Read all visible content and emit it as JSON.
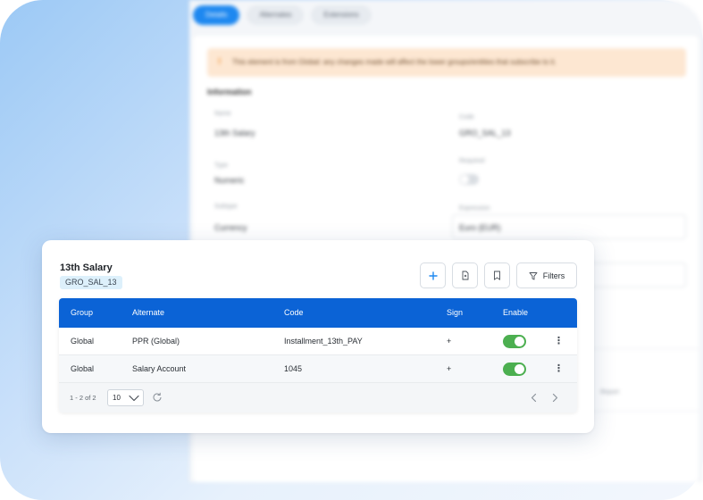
{
  "background": {
    "tabs": [
      "Details",
      "Alternates",
      "Extensions"
    ],
    "warning": "This element is from Global: any changes made will affect the lower groups/entities that subscribe to it.",
    "section_title": "Information",
    "fields": {
      "name_label": "Name",
      "name_value": "13th Salary",
      "code_label": "Code",
      "code_value": "GRO_SAL_13",
      "type_label": "Type",
      "type_value": "Numeric",
      "required_label": "Required",
      "subtype_label": "Subtype",
      "subtype_value": "Currency",
      "expression_label": "Expression",
      "expression_value": "Euro (EUR)"
    },
    "side_note": "Report"
  },
  "card": {
    "title": "13th Salary",
    "code": "GRO_SAL_13",
    "toolbar": {
      "add_icon": "plus-icon",
      "export_icon": "export-file-icon",
      "bookmark_icon": "bookmark-icon",
      "filter_icon": "filter-icon",
      "filters_label": "Filters"
    },
    "table": {
      "columns": [
        "Group",
        "Alternate",
        "Code",
        "Sign",
        "Enable"
      ],
      "rows": [
        {
          "group": "Global",
          "alternate": "PPR (Global)",
          "code": "Installment_13th_PAY",
          "sign": "+",
          "enabled": true
        },
        {
          "group": "Global",
          "alternate": "Salary Account",
          "code": "1045",
          "sign": "+",
          "enabled": true
        }
      ],
      "footer": {
        "range": "1 - 2 of 2",
        "page_size": "10"
      }
    }
  },
  "colors": {
    "header": "#0b63d6",
    "toggle_on": "#4caf50",
    "badge": "#ddf0fb",
    "accent": "#1e88f0"
  }
}
